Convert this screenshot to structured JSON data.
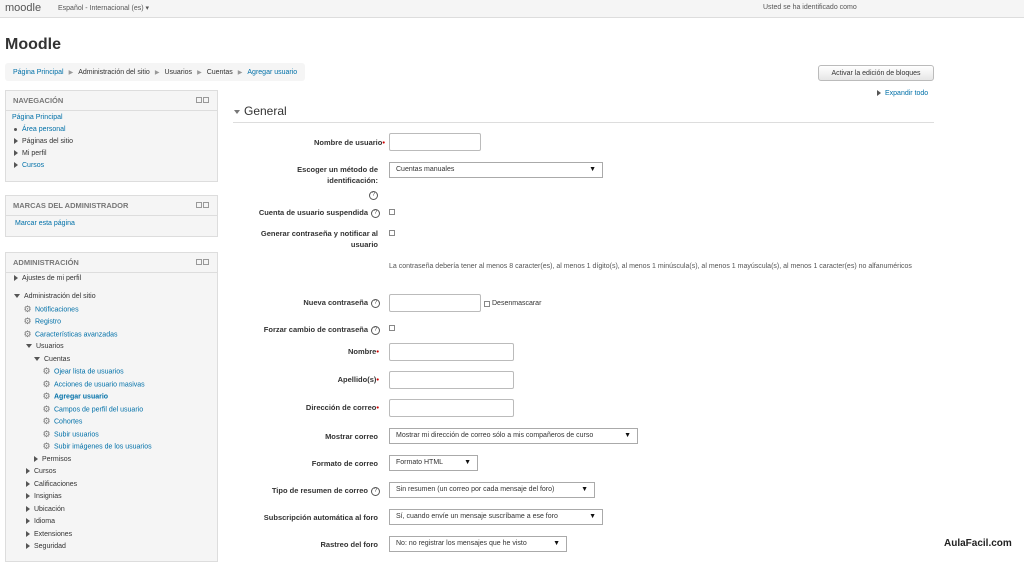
{
  "topbar": {
    "brand": "moodle",
    "language": "Español - Internacional (es) ▾",
    "logged_in": "Usted se ha identificado como"
  },
  "page": {
    "title": "Moodle"
  },
  "breadcrumb": [
    "Página Principal",
    "Administración del sitio",
    "Usuarios",
    "Cuentas",
    "Agregar usuario"
  ],
  "buttons": {
    "edit_blocks": "Activar la edición de bloques",
    "expand_all": "Expandir todo"
  },
  "blocks": {
    "navigation": {
      "title": "NAVEGACIÓN",
      "items": [
        "Página Principal",
        "Área personal",
        "Páginas del sitio",
        "Mi perfil",
        "Cursos"
      ]
    },
    "admin_bookmarks": {
      "title": "MARCAS DEL ADMINISTRADOR",
      "link": "Marcar esta página"
    },
    "administration": {
      "title": "ADMINISTRACIÓN",
      "items": [
        "Ajustes de mi perfil",
        "Administración del sitio",
        "Notificaciones",
        "Registro",
        "Características avanzadas",
        "Usuarios",
        "Cuentas",
        "Ojear lista de usuarios",
        "Acciones de usuario masivas",
        "Agregar usuario",
        "Campos de perfil del usuario",
        "Cohortes",
        "Subir usuarios",
        "Subir imágenes de los usuarios",
        "Permisos",
        "Cursos",
        "Calificaciones",
        "Insignias",
        "Ubicación",
        "Idioma",
        "Extensiones",
        "Seguridad"
      ]
    }
  },
  "form": {
    "section": "General",
    "username_label": "Nombre de usuario",
    "auth_label": "Escoger un método de identificación:",
    "auth_value": "Cuentas manuales",
    "suspended_label": "Cuenta de usuario suspendida",
    "generate_pw_label": "Generar contraseña y notificar al usuario",
    "password_note": "La contraseña debería tener al menos 8 caracter(es), al menos 1 dígito(s), al menos 1 minúscula(s), al menos 1 mayúscula(s), al menos 1 caracter(es) no alfanuméricos",
    "new_password_label": "Nueva contraseña",
    "unmask_label": "Desenmascarar",
    "force_change_label": "Forzar cambio de contraseña",
    "firstname_label": "Nombre",
    "lastname_label": "Apellido(s)",
    "email_label": "Dirección de correo",
    "maildisplay_label": "Mostrar correo",
    "maildisplay_value": "Mostrar mi dirección de correo sólo a mis compañeros de curso",
    "mailformat_label": "Formato de correo",
    "mailformat_value": "Formato HTML",
    "maildigest_label": "Tipo de resumen de correo",
    "maildigest_value": "Sin resumen (un correo por cada mensaje del foro)",
    "autosubscribe_label": "Subscripción automática al foro",
    "autosubscribe_value": "Sí, cuando envíe un mensaje suscríbame a ese foro",
    "trackforums_label": "Rastreo del foro",
    "trackforums_value": "No: no registrar los mensajes que he visto"
  },
  "watermark": "AulaFacil.com"
}
